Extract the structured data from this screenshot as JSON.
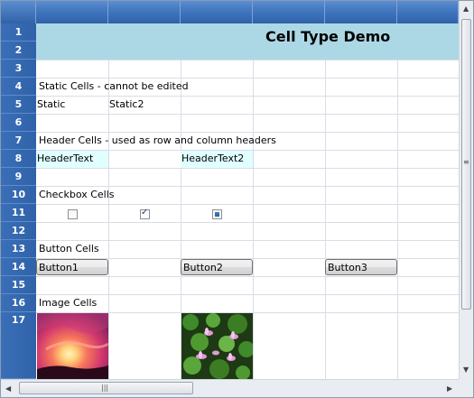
{
  "title": "Cell Type Demo",
  "row_numbers": [
    "1",
    "2",
    "3",
    "4",
    "5",
    "6",
    "7",
    "8",
    "9",
    "10",
    "11",
    "12",
    "13",
    "14",
    "15",
    "16",
    "17"
  ],
  "rows": {
    "static_title": "Static Cells - cannot be edited",
    "static_a": "Static",
    "static_b": "Static2",
    "header_title": "Header Cells - used as row and column headers",
    "header_a": "HeaderText",
    "header_b": "HeaderText2",
    "checkbox_title": "Checkbox Cells",
    "checkboxes": [
      {
        "state": "unchecked"
      },
      {
        "state": "checked"
      },
      {
        "state": "indeterminate"
      }
    ],
    "button_title": "Button Cells",
    "button_1": "Button1",
    "button_2": "Button2",
    "button_3": "Button3",
    "image_title": "Image Cells",
    "images": [
      "sunset-image",
      "water-lilies-image"
    ]
  },
  "scrollbars": {
    "vertical_grip": "≡",
    "horizontal_grip": "|||",
    "up": "▲",
    "down": "▼",
    "left": "◀",
    "right": "▶"
  },
  "colors": {
    "header_blue": "#2f62a8",
    "title_band": "#acd8e6",
    "header_cell": "#e0ffff"
  }
}
